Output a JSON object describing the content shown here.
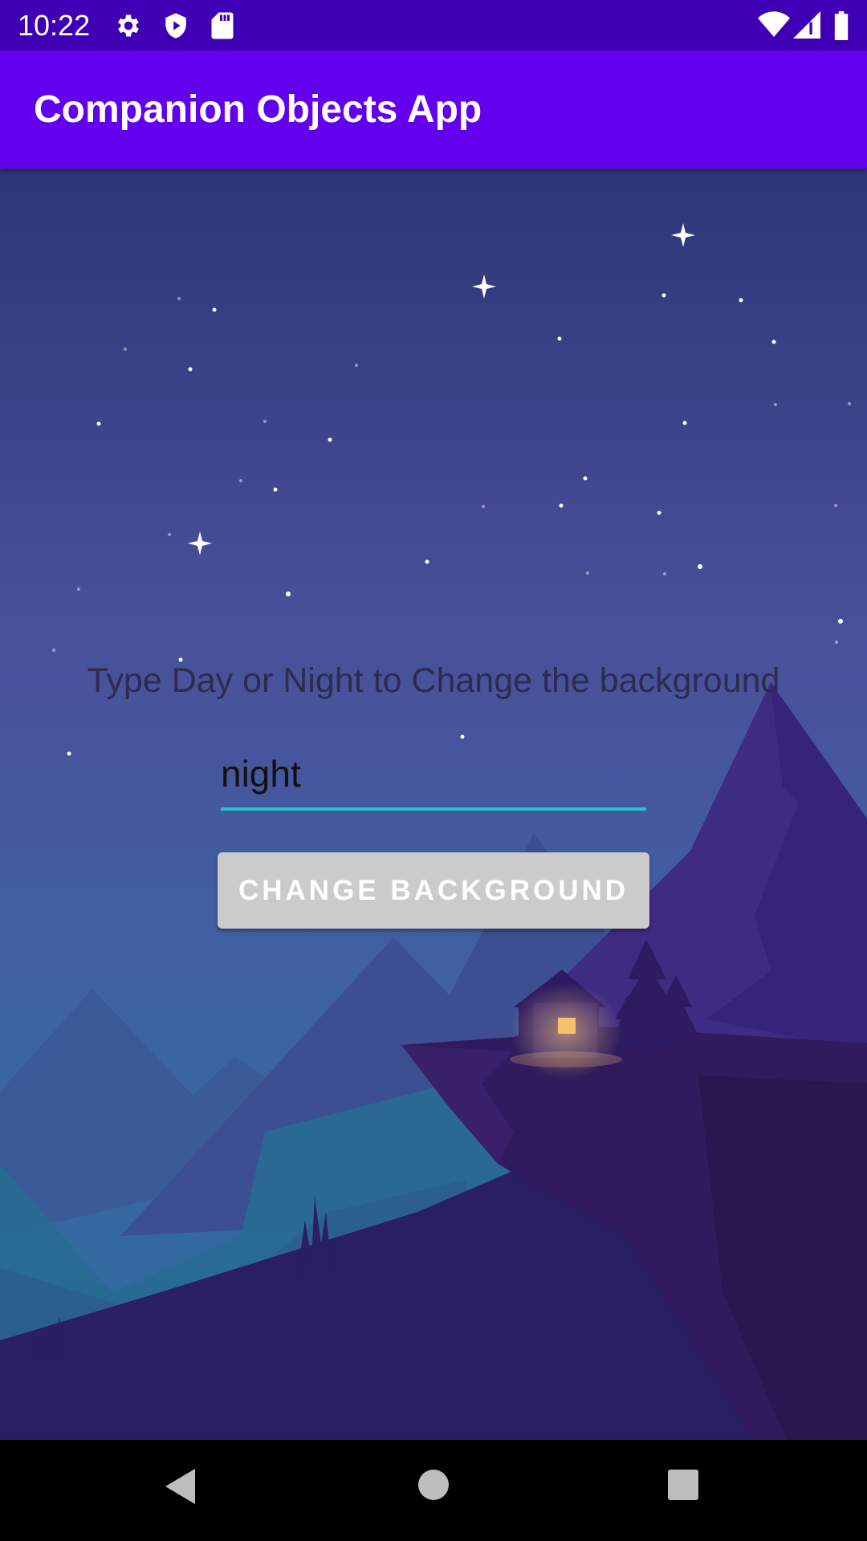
{
  "status_bar": {
    "time": "10:22",
    "icons": [
      "settings-gear-icon",
      "shield-icon",
      "sd-card-icon",
      "wifi-icon",
      "signal-icon",
      "battery-icon"
    ]
  },
  "app_bar": {
    "title": "Companion Objects App"
  },
  "main": {
    "prompt": "Type Day or Night to Change the background",
    "input_value": "night",
    "button_label": "CHANGE BACKGROUND"
  },
  "nav_bar": {
    "buttons": [
      "back-icon",
      "home-icon",
      "recents-icon"
    ]
  },
  "colors": {
    "status_bar": "#3f00b5",
    "app_bar": "#6200ee",
    "input_underline": "#1bc9c9",
    "button": "#cbcbcb"
  }
}
